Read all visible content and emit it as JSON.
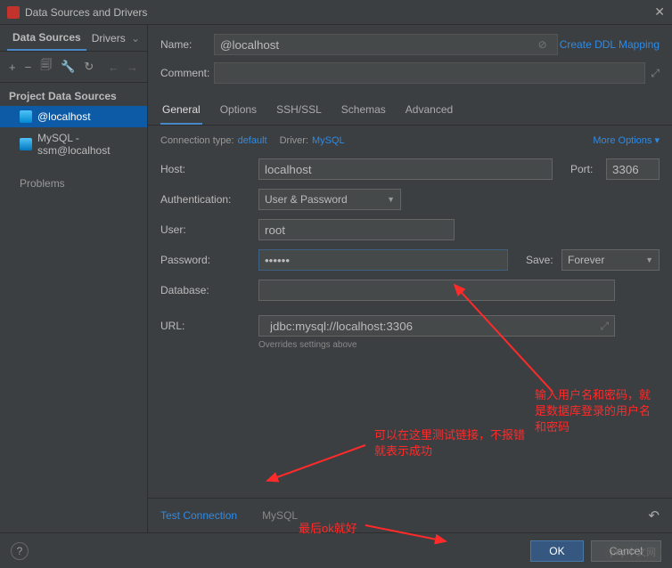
{
  "window": {
    "title": "Data Sources and Drivers"
  },
  "leftTabs": {
    "dataSources": "Data Sources",
    "drivers": "Drivers"
  },
  "sectionLabel": "Project Data Sources",
  "dataSources": [
    {
      "label": "@localhost"
    },
    {
      "label": "MySQL - ssm@localhost"
    }
  ],
  "problems": "Problems",
  "form": {
    "nameLabel": "Name:",
    "nameValue": "@localhost",
    "ddlLink": "Create DDL Mapping",
    "commentLabel": "Comment:"
  },
  "tabs": {
    "general": "General",
    "options": "Options",
    "ssh": "SSH/SSL",
    "schemas": "Schemas",
    "advanced": "Advanced"
  },
  "conn": {
    "typeLabel": "Connection type:",
    "typeValue": "default",
    "driverLabel": "Driver:",
    "driverValue": "MySQL",
    "more": "More Options"
  },
  "fields": {
    "hostLabel": "Host:",
    "hostValue": "localhost",
    "portLabel": "Port:",
    "portValue": "3306",
    "authLabel": "Authentication:",
    "authValue": "User & Password",
    "userLabel": "User:",
    "userValue": "root",
    "passLabel": "Password:",
    "passValue": "••••••",
    "saveLabel": "Save:",
    "saveValue": "Forever",
    "dbLabel": "Database:",
    "dbValue": "",
    "urlLabel": "URL:",
    "urlValue": "jdbc:mysql://localhost:3306",
    "urlHint": "Overrides settings above"
  },
  "bottom": {
    "test": "Test Connection",
    "driver": "MySQL"
  },
  "buttons": {
    "ok": "OK",
    "cancel": "Cancel"
  },
  "annotations": {
    "a1": "输入用户名和密码，就是数据库登录的用户名和密码",
    "a2": "可以在这里测试链接，不报错就表示成功",
    "a3": "最后ok就好"
  },
  "watermark": "php中文网"
}
